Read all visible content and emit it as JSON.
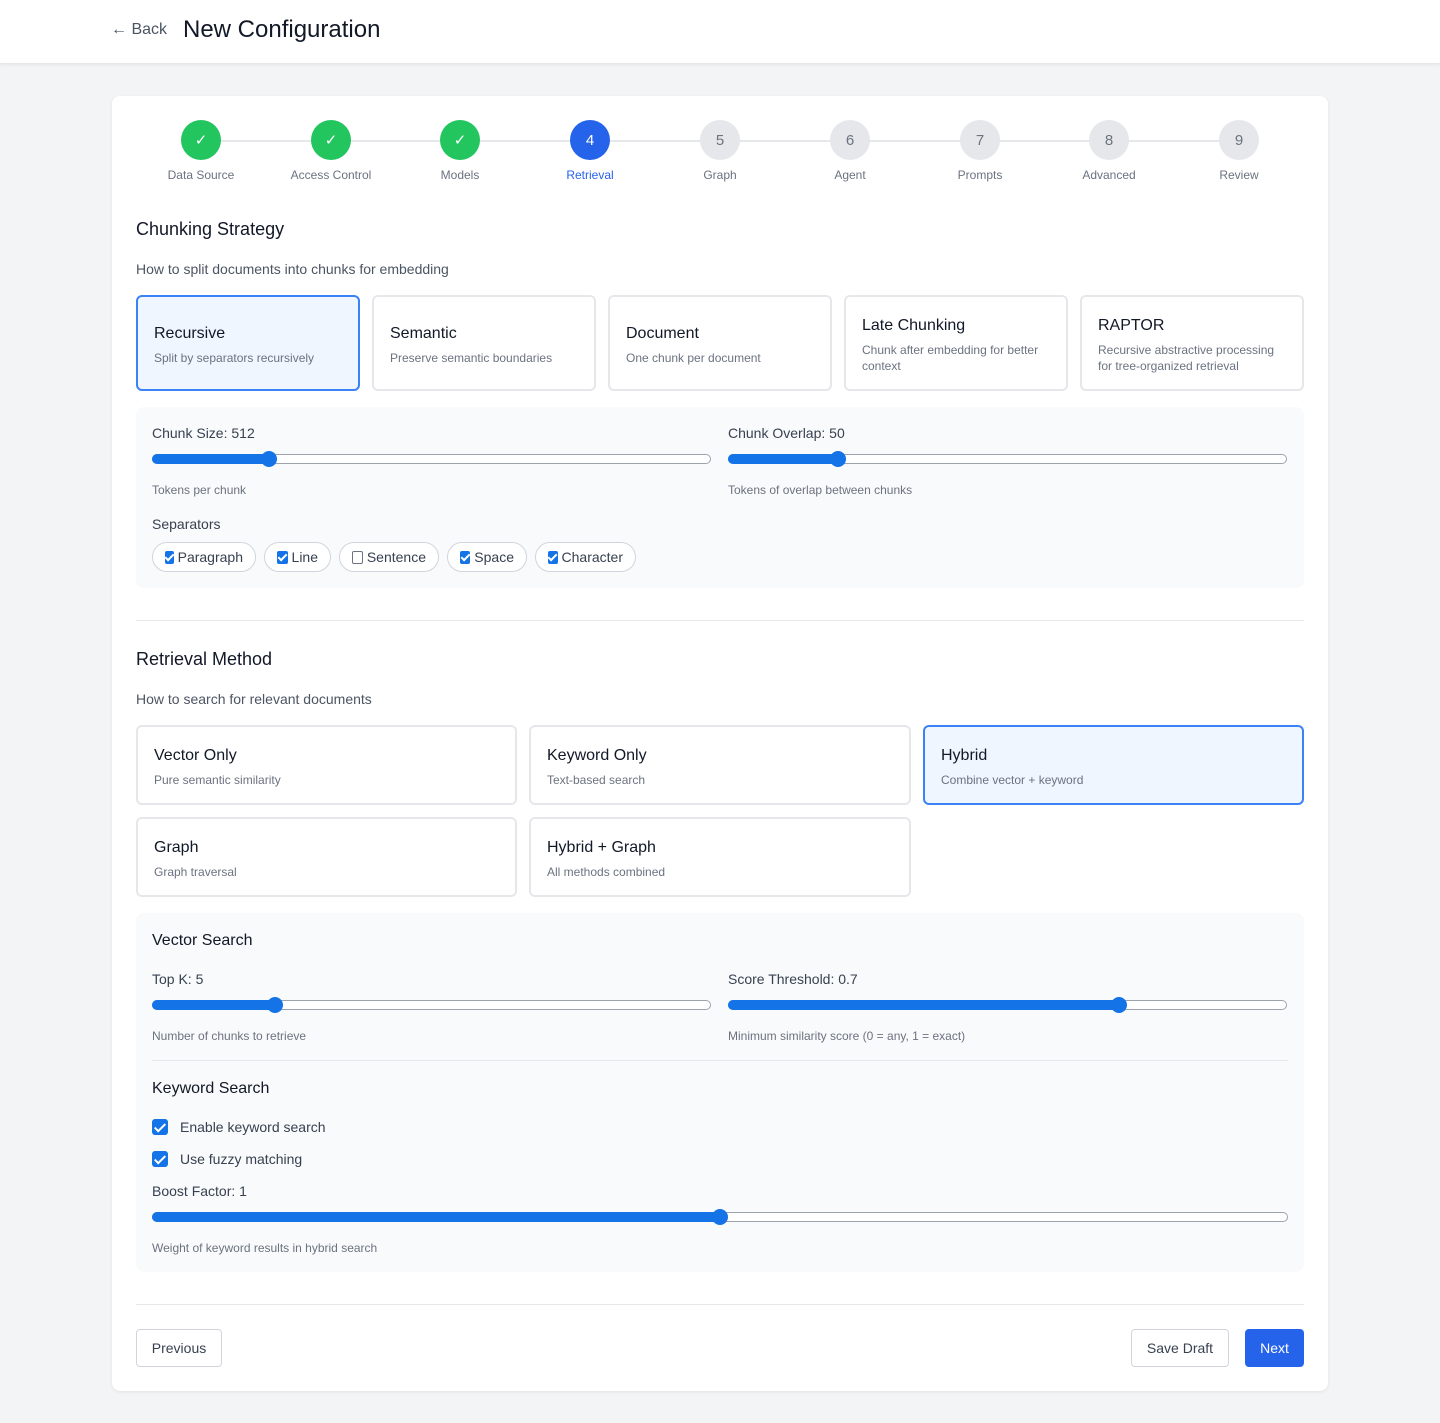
{
  "header": {
    "back_label": "← Back",
    "title": "New Configuration"
  },
  "steps": [
    {
      "number": "1",
      "icon": "✓",
      "label": "Data Source",
      "state": "done"
    },
    {
      "number": "2",
      "icon": "✓",
      "label": "Access Control",
      "state": "done"
    },
    {
      "number": "3",
      "icon": "✓",
      "label": "Models",
      "state": "done"
    },
    {
      "number": "4",
      "icon": "4",
      "label": "Retrieval",
      "state": "active"
    },
    {
      "number": "5",
      "icon": "5",
      "label": "Graph",
      "state": "todo"
    },
    {
      "number": "6",
      "icon": "6",
      "label": "Agent",
      "state": "todo"
    },
    {
      "number": "7",
      "icon": "7",
      "label": "Prompts",
      "state": "todo"
    },
    {
      "number": "8",
      "icon": "8",
      "label": "Advanced",
      "state": "todo"
    },
    {
      "number": "9",
      "icon": "9",
      "label": "Review",
      "state": "todo"
    }
  ],
  "chunking": {
    "title": "Chunking Strategy",
    "subtitle": "How to split documents into chunks for embedding",
    "options": [
      {
        "title": "Recursive",
        "desc": "Split by separators recursively",
        "selected": true
      },
      {
        "title": "Semantic",
        "desc": "Preserve semantic boundaries",
        "selected": false
      },
      {
        "title": "Document",
        "desc": "One chunk per document",
        "selected": false
      },
      {
        "title": "Late Chunking",
        "desc": "Chunk after embedding for better context",
        "selected": false
      },
      {
        "title": "RAPTOR",
        "desc": "Recursive abstractive processing for tree-organized retrieval",
        "selected": false
      }
    ],
    "chunk_size": {
      "label": "Chunk Size: 512",
      "hint": "Tokens per chunk",
      "fraction": 0.21
    },
    "chunk_overlap": {
      "label": "Chunk Overlap: 50",
      "hint": "Tokens of overlap between chunks",
      "fraction": 0.197
    },
    "separators_label": "Separators",
    "separators": [
      {
        "label": "Paragraph",
        "checked": true
      },
      {
        "label": "Line",
        "checked": true
      },
      {
        "label": "Sentence",
        "checked": false
      },
      {
        "label": "Space",
        "checked": true
      },
      {
        "label": "Character",
        "checked": true
      }
    ]
  },
  "retrieval": {
    "title": "Retrieval Method",
    "subtitle": "How to search for relevant documents",
    "options": [
      {
        "title": "Vector Only",
        "desc": "Pure semantic similarity",
        "selected": false
      },
      {
        "title": "Keyword Only",
        "desc": "Text-based search",
        "selected": false
      },
      {
        "title": "Hybrid",
        "desc": "Combine vector + keyword",
        "selected": true
      },
      {
        "title": "Graph",
        "desc": "Graph traversal",
        "selected": false
      },
      {
        "title": "Hybrid + Graph",
        "desc": "All methods combined",
        "selected": false
      }
    ],
    "vector_search": {
      "title": "Vector Search",
      "top_k": {
        "label": "Top K: 5",
        "hint": "Number of chunks to retrieve",
        "fraction": 0.22
      },
      "score_threshold": {
        "label": "Score Threshold: 0.7",
        "hint": "Minimum similarity score (0 = any, 1 = exact)",
        "fraction": 0.7
      }
    },
    "keyword_search": {
      "title": "Keyword Search",
      "enable_label": "Enable keyword search",
      "enable_checked": true,
      "fuzzy_label": "Use fuzzy matching",
      "fuzzy_checked": true,
      "boost": {
        "label": "Boost Factor: 1",
        "hint": "Weight of keyword results in hybrid search",
        "fraction": 0.5
      }
    }
  },
  "footer": {
    "previous_label": "Previous",
    "save_draft_label": "Save Draft",
    "next_label": "Next"
  },
  "colors": {
    "accent": "#2563eb",
    "done": "#22c55e",
    "selected_bg": "#eff6ff",
    "selected_border": "#3b82f6"
  }
}
